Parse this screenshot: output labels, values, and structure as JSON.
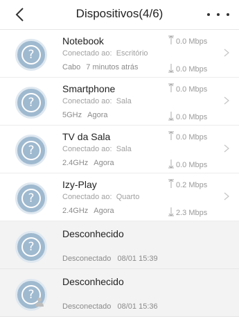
{
  "header": {
    "title": "Dispositivos(4/6)"
  },
  "devices": [
    {
      "name": "Notebook",
      "connected_label": "Conectado ao:",
      "location": "Escritório",
      "band": "Cabo",
      "time": "7 minutos atrás",
      "upload": "0.0 Mbps",
      "download": "0.0 Mbps"
    },
    {
      "name": "Smartphone",
      "connected_label": "Conectado ao:",
      "location": "Sala",
      "band": "5GHz",
      "time": "Agora",
      "upload": "0.0 Mbps",
      "download": "0.0 Mbps"
    },
    {
      "name": "TV da Sala",
      "connected_label": "Conectado ao:",
      "location": "Sala",
      "band": "2.4GHz",
      "time": "Agora",
      "upload": "0.0 Mbps",
      "download": "0.0 Mbps"
    },
    {
      "name": "Izy-Play",
      "connected_label": "Conectado ao:",
      "location": "Quarto",
      "band": "2.4GHz",
      "time": "Agora",
      "upload": "0.2 Mbps",
      "download": "2.3 Mbps"
    }
  ],
  "offline": [
    {
      "name": "Desconhecido",
      "status": "Desconectado",
      "time": "08/01 15:39"
    },
    {
      "name": "Desconhecido",
      "status": "Desconectado",
      "time": "08/01 15:36"
    }
  ],
  "colors": {
    "avatar": "#9fb9cf",
    "offline_bg": "#f3f3f3"
  }
}
